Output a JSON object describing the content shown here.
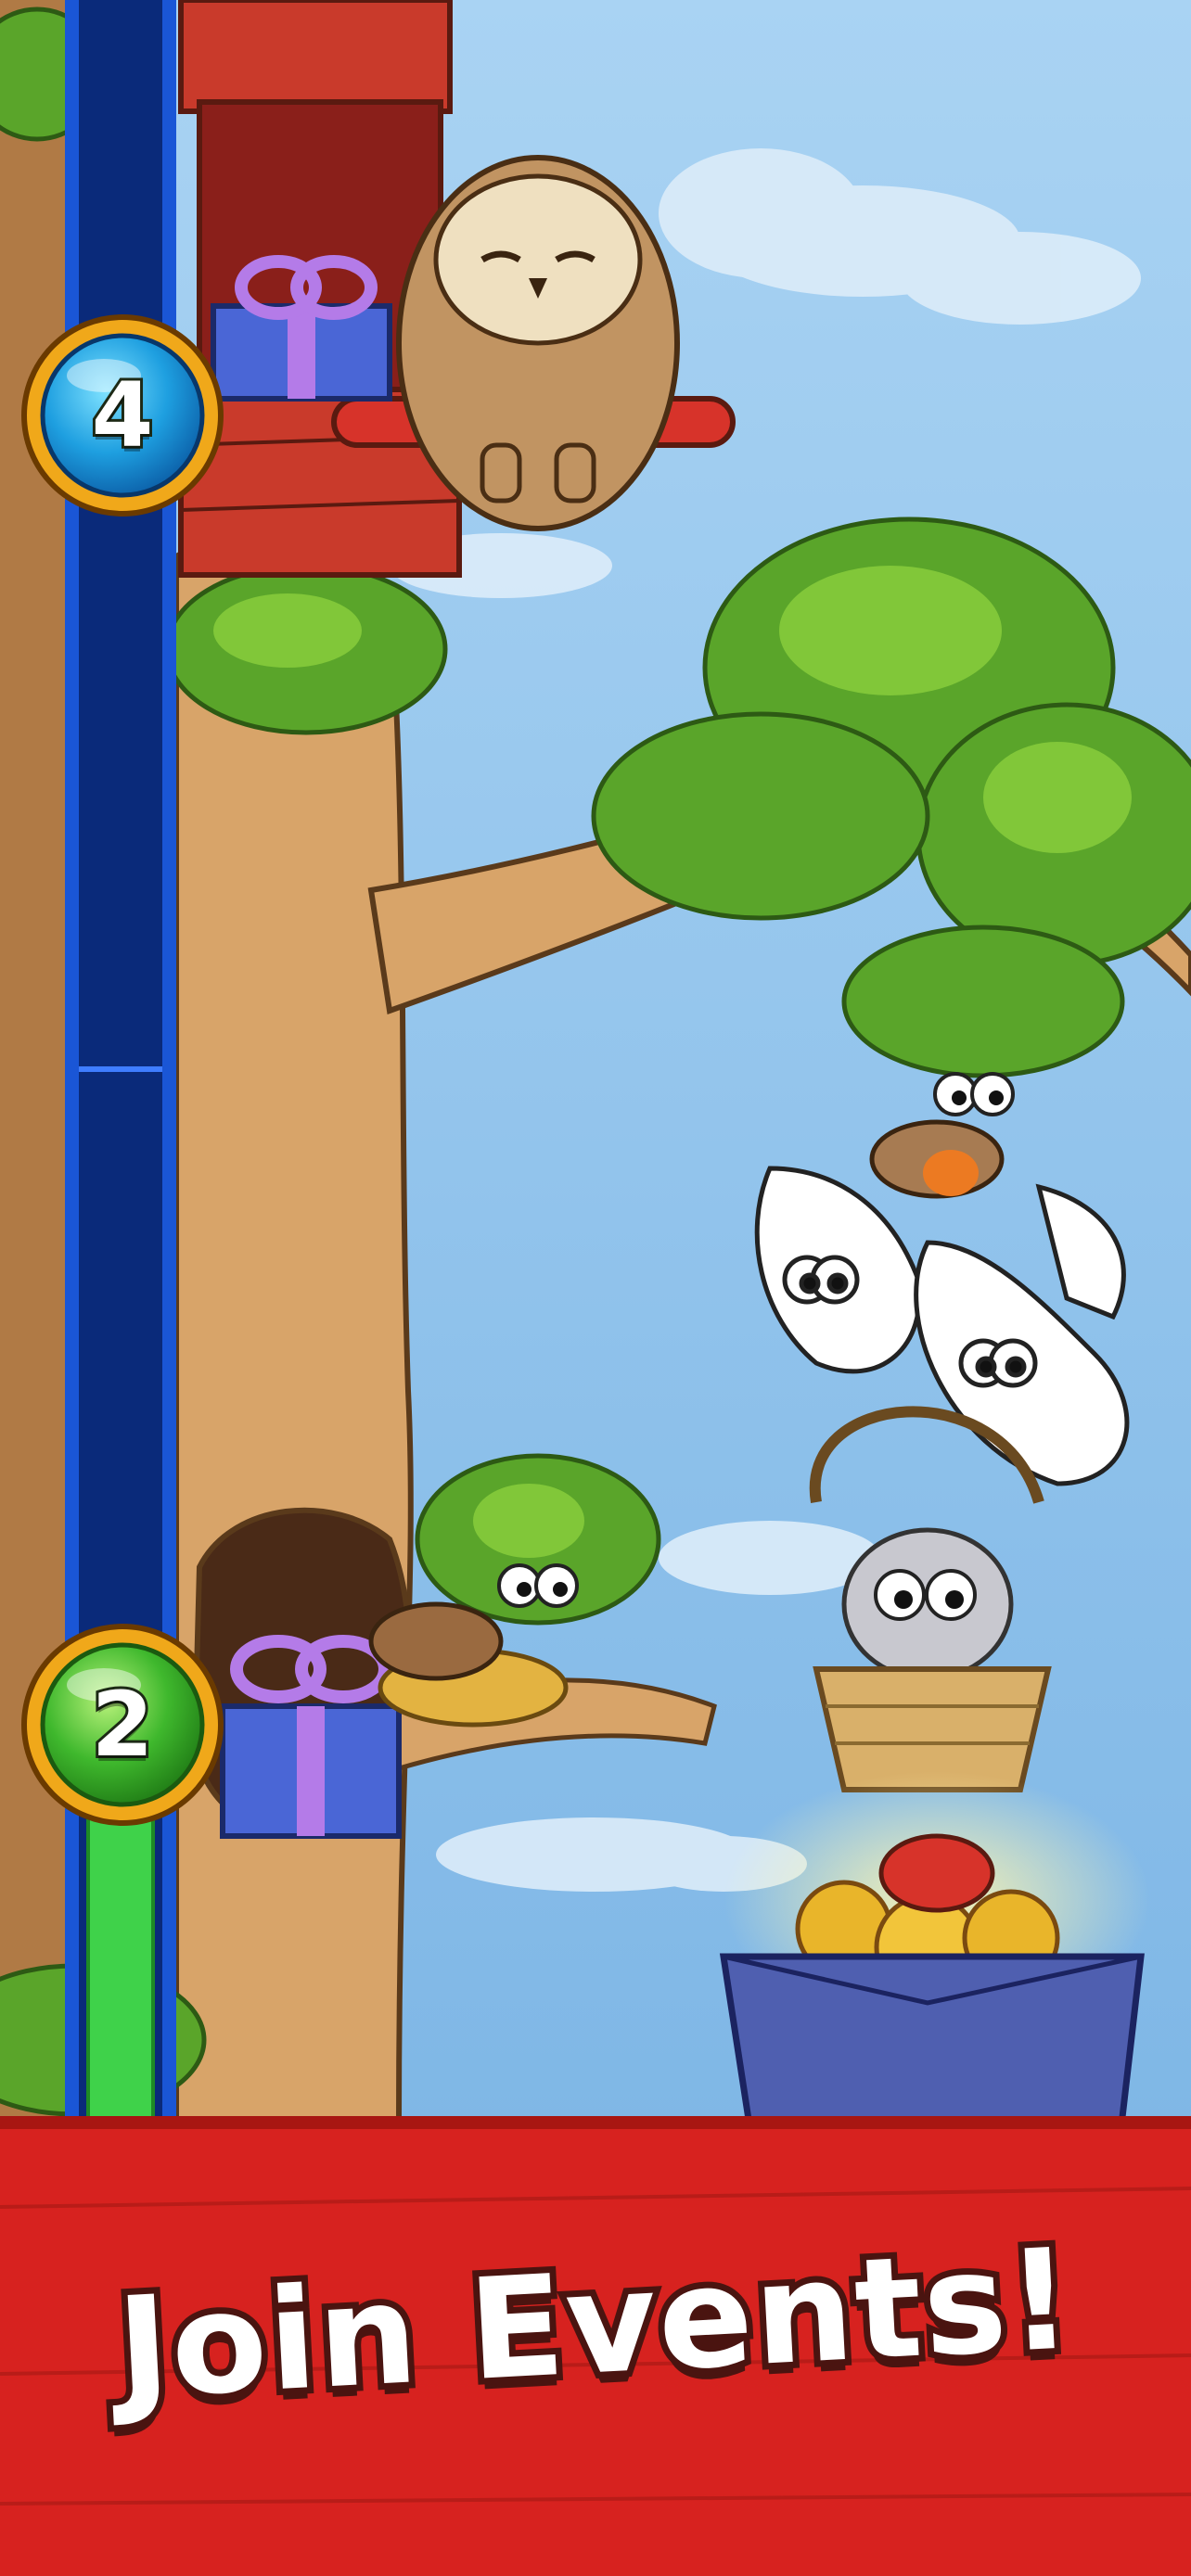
{
  "progress": {
    "milestones": [
      {
        "level": "4",
        "color": "#1e9fe0",
        "state": "locked"
      },
      {
        "level": "2",
        "color": "#3fb82d",
        "state": "reached"
      }
    ],
    "fill_fraction_between_2_and_4": 0.0
  },
  "banner": {
    "text": "Join Events!",
    "color": "#d7221f"
  },
  "colors": {
    "sky": "#8fc3ec",
    "track": "#0a2a7a",
    "track_fill": "#3fd24a",
    "tree": "#d8a469",
    "leaves": "#5aa52a"
  },
  "icons": [
    "owl-icon",
    "gift-box-icon",
    "robin-icon",
    "dove-icon",
    "cat-in-basket-icon",
    "treasure-box-icon",
    "bird-in-nest-icon"
  ]
}
